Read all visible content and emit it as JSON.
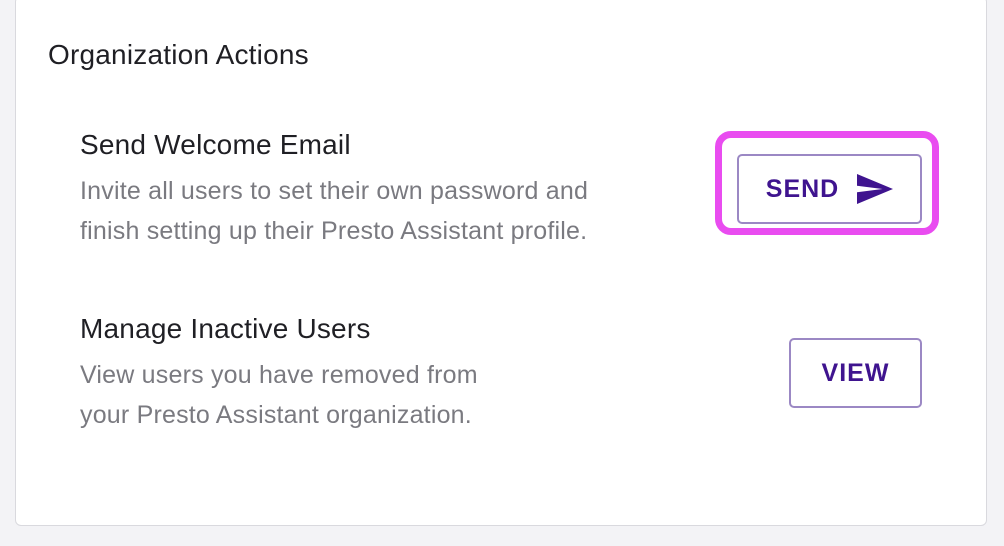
{
  "section": {
    "title": "Organization Actions"
  },
  "actions": [
    {
      "title": "Send Welcome Email",
      "description_lines": [
        "Invite all users to set their own password and",
        "finish setting up their Presto Assistant profile."
      ],
      "button_label": "SEND",
      "button_icon": "send-icon",
      "highlighted": true
    },
    {
      "title": "Manage Inactive Users",
      "description_lines": [
        "View users you have removed from",
        "your Presto Assistant organization."
      ],
      "button_label": "VIEW"
    }
  ],
  "colors": {
    "accent": "#3f148f",
    "button_border": "#9b88c4",
    "highlight": "#e94cf0",
    "muted_text": "#7a7a80",
    "primary_text": "#1f1f24"
  }
}
